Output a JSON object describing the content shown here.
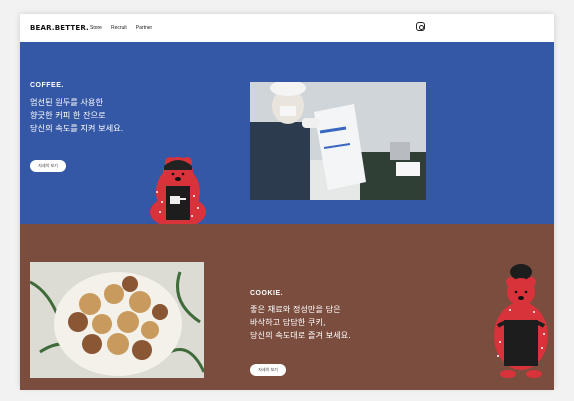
{
  "nav": {
    "logo": "BEAR.BETTER.",
    "items": [
      "Store",
      "Recruit",
      "Partner"
    ],
    "social_icon": "instagram-icon"
  },
  "coffee": {
    "heading": "COFFEE.",
    "lines": [
      "엄선된 원두를 사용한",
      "향긋한 커피 한 잔으로",
      "당신의 속도를 지켜 보세요."
    ],
    "button": "자세히 보기",
    "bg": "#3457a6"
  },
  "cookie": {
    "heading": "COOKIE.",
    "lines": [
      "좋은 재료와 정성만을 담은",
      "바삭하고 담담한 쿠키,",
      "당신의 속도대로 즐겨 보세요."
    ],
    "button": "자세히 보기",
    "bg": "#7b4d3e"
  }
}
